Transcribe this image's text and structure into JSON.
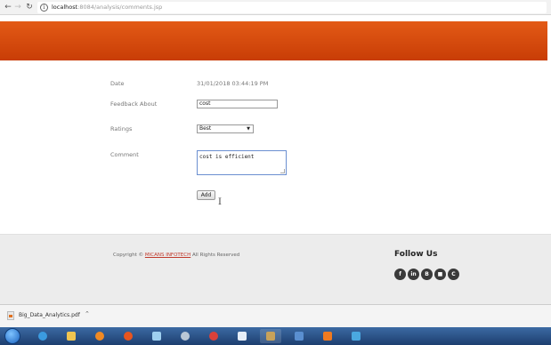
{
  "browser": {
    "url_host": "localhost",
    "url_path": ":8084/analysis/comments.jsp"
  },
  "form": {
    "date_label": "Date",
    "date_value": "31/01/2018 03:44:19 PM",
    "feedback_label": "Feedback About",
    "feedback_value": "cost",
    "ratings_label": "Ratings",
    "ratings_selected": "Best",
    "comment_label": "Comment",
    "comment_value": "cost is efficient",
    "add_label": "Add"
  },
  "footer": {
    "copyright_prefix": "Copyright © ",
    "company": "MICANS INFOTECH",
    "copyright_suffix": " All Rights Reserved",
    "follow_us": "Follow Us",
    "social_icons": [
      "facebook-icon",
      "linkedin-icon",
      "blogger-icon",
      "delicious-icon",
      "contact-icon"
    ]
  },
  "downloads": {
    "file_name": "Big_Data_Analytics.pdf"
  },
  "colors": {
    "banner": "#d94b0c",
    "link": "#c0392b",
    "taskbar": "#1d3e6f"
  }
}
